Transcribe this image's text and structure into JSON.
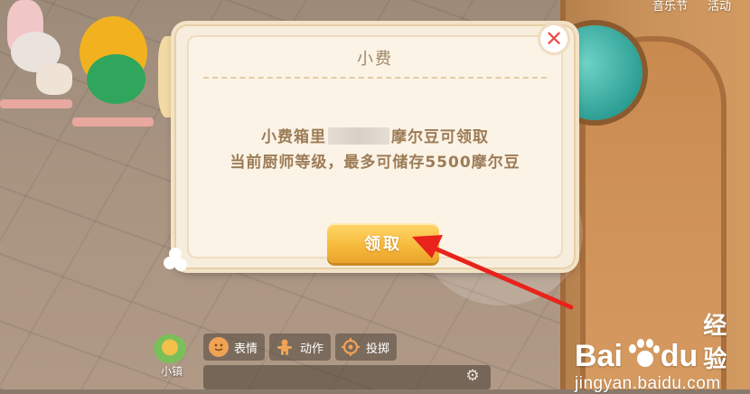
{
  "top_menu": {
    "music_festival": "音乐节",
    "activity": "活动"
  },
  "dialog": {
    "title": "小费",
    "message_part1": "小费箱里",
    "message_part2": "摩尔豆可领取",
    "message_line2": "当前厨师等级，最多可储存5500摩尔豆",
    "claim_button": "领取",
    "close_icon": "close-icon"
  },
  "bottom_bar": {
    "actions": [
      {
        "label": "表情",
        "icon": "emoji-face-icon"
      },
      {
        "label": "动作",
        "icon": "gingerbread-action-icon"
      },
      {
        "label": "投掷",
        "icon": "throw-target-icon"
      }
    ],
    "town_label": "小镇",
    "settings_icon": "gear-icon"
  },
  "watermark": {
    "logo_left": "Bai",
    "logo_right": "du",
    "logo_cn": "经验",
    "url": "jingyan.baidu.com"
  },
  "colors": {
    "dialog_bg": "#f7eddc",
    "title_text": "#a08665",
    "message_text": "#9c7c57",
    "button_gold": "#f6b93a",
    "close_red": "#e9524b",
    "annotation_arrow": "#e8231c"
  }
}
